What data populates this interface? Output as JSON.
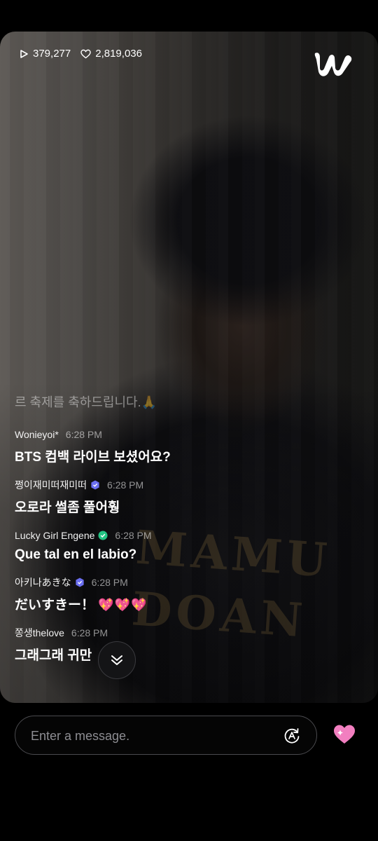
{
  "stats": {
    "views": "379,277",
    "likes": "2,819,036"
  },
  "brand": {
    "logo_icon": "weverse-w-logo"
  },
  "chat": {
    "faded_line": "르 축제를 축하드립니다.🙏",
    "messages": [
      {
        "user": "Wonieyoi*",
        "time": "6:28 PM",
        "badge": null,
        "text": "BTS 컴백 라이브 보셨어요?"
      },
      {
        "user": "쩡이재미떠재미떠",
        "time": "6:28 PM",
        "badge": "purple-shield-badge",
        "text": "오로라 썰좀 풀어훵"
      },
      {
        "user": "Lucky Girl Engene",
        "time": "6:28 PM",
        "badge": "green-shield-badge",
        "text": "Que tal en el labio?"
      },
      {
        "user": "아키나あきな",
        "time": "6:28 PM",
        "badge": "purple-shield-badge",
        "text": "だいすきー！",
        "emoji": "💖💖💖"
      },
      {
        "user": "쫑생thelove",
        "time": "6:28 PM",
        "badge": null,
        "text": "그래그래 귀만"
      }
    ]
  },
  "composer": {
    "placeholder": "Enter a message.",
    "translate_icon": "translate-icon",
    "heart_icon": "sparkle-heart-icon"
  },
  "colors": {
    "heart": "#f27fc0",
    "purple_badge": "#6b6ff0",
    "green_badge": "#23c483"
  }
}
